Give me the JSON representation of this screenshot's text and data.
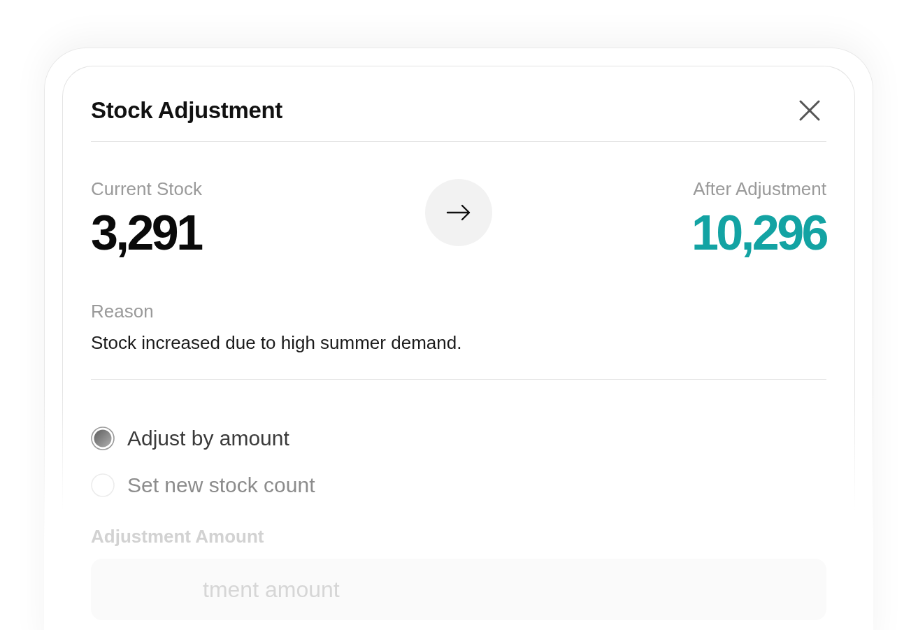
{
  "dialog": {
    "title": "Stock Adjustment"
  },
  "current_stock": {
    "label": "Current Stock",
    "value": "3,291"
  },
  "after_adjustment": {
    "label": "After Adjustment",
    "value": "10,296"
  },
  "reason": {
    "label": "Reason",
    "text": "Stock increased due to high summer demand."
  },
  "adjustment_modes": [
    {
      "label": "Adjust by amount",
      "selected": true
    },
    {
      "label": "Set new stock count",
      "selected": false
    }
  ],
  "adjustment_amount": {
    "label": "Adjustment Amount",
    "placeholder": "tment amount"
  }
}
